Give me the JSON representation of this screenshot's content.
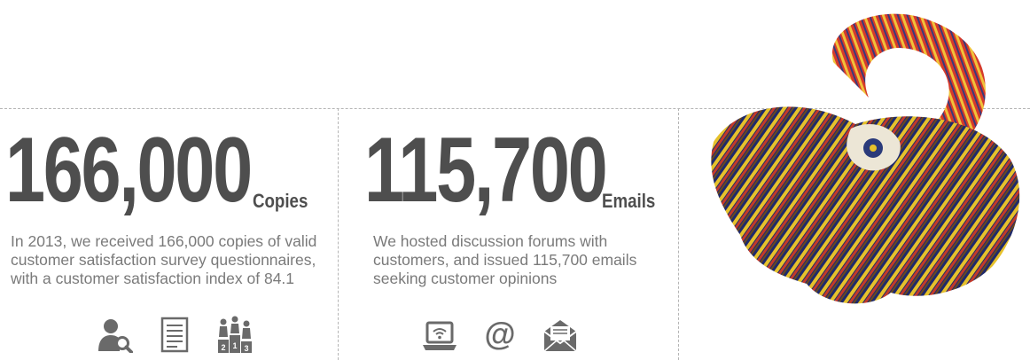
{
  "stats": [
    {
      "number": "166,000",
      "unit": "Copies",
      "description": "In 2013, we received 166,000 copies of valid customer satisfaction survey questionnaires, with a customer satisfaction index of 84.1",
      "icons": [
        "customer-search-icon",
        "document-icon",
        "podium-icon"
      ],
      "podium_labels": [
        "2",
        "1",
        "3"
      ]
    },
    {
      "number": "115,700",
      "unit": "Emails",
      "description": "We hosted discussion forums with customers, and issued 115,700 emails seeking customer opinions",
      "icons": [
        "laptop-wifi-icon",
        "at-sign-icon",
        "envelope-icon"
      ],
      "at_symbol": "@"
    }
  ],
  "colors": {
    "number": "#4e4e4e",
    "text": "#7a7a7a",
    "icon": "#6a6a6a",
    "divider": "#b5b5b5"
  }
}
